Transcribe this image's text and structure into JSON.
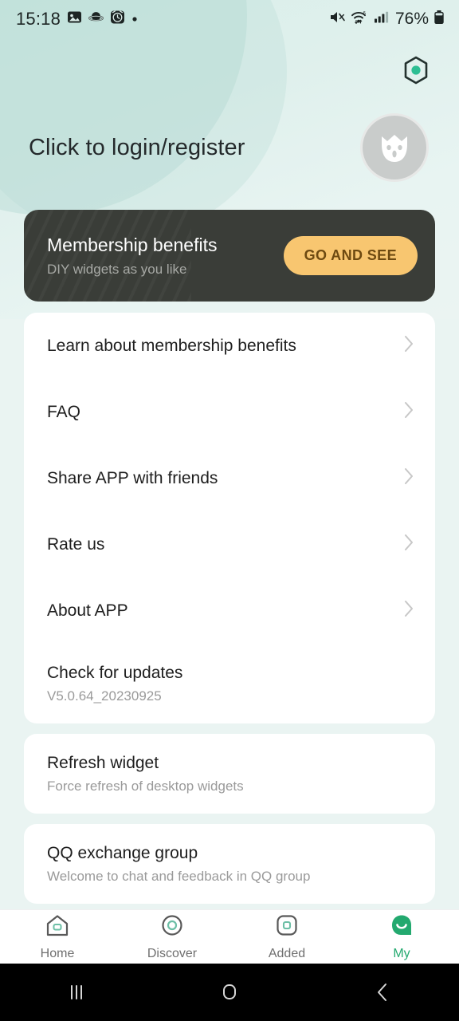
{
  "status_bar": {
    "time": "15:18",
    "left_icons": [
      "image-icon",
      "planet-icon",
      "alarm-clock-icon",
      "dot-icon"
    ],
    "right_icons": [
      "mute-icon",
      "wifi-icon",
      "cellular-signal-icon",
      "battery-icon"
    ],
    "battery_text": "76%"
  },
  "header": {
    "settings_icon": "hexagon-settings-icon",
    "login_text": "Click to login/register",
    "avatar_icon": "cat-avatar-icon"
  },
  "banner": {
    "title": "Membership benefits",
    "subtitle": "DIY widgets as you like",
    "button_label": "GO AND SEE",
    "button_color": "#F8C670",
    "button_text_color": "#6E4A11",
    "background_color": "#3A3D38"
  },
  "cards": [
    {
      "rows": [
        {
          "title": "Learn about membership benefits",
          "subtitle": "",
          "chevron": true
        },
        {
          "title": "FAQ",
          "subtitle": "",
          "chevron": true
        },
        {
          "title": "Share APP with friends",
          "subtitle": "",
          "chevron": true
        },
        {
          "title": "Rate us",
          "subtitle": "",
          "chevron": true
        },
        {
          "title": "About APP",
          "subtitle": "",
          "chevron": true
        },
        {
          "title": "Check for updates",
          "subtitle": "V5.0.64_20230925",
          "chevron": false
        }
      ]
    },
    {
      "rows": [
        {
          "title": "Refresh widget",
          "subtitle": "Force refresh of desktop widgets",
          "chevron": false
        }
      ]
    },
    {
      "rows": [
        {
          "title": "QQ exchange group",
          "subtitle": "Welcome to chat and feedback in QQ group",
          "chevron": false
        }
      ]
    }
  ],
  "tabbar": {
    "active_color": "#23A96F",
    "inactive_color": "#6F6F6F",
    "items": [
      {
        "label": "Home",
        "icon": "home-icon",
        "active": false
      },
      {
        "label": "Discover",
        "icon": "discover-icon",
        "active": false
      },
      {
        "label": "Added",
        "icon": "added-icon",
        "active": false
      },
      {
        "label": "My",
        "icon": "my-profile-icon",
        "active": true
      }
    ]
  },
  "navbar": {
    "items": [
      {
        "icon": "recents-icon"
      },
      {
        "icon": "home-button-icon"
      },
      {
        "icon": "back-icon"
      }
    ]
  }
}
